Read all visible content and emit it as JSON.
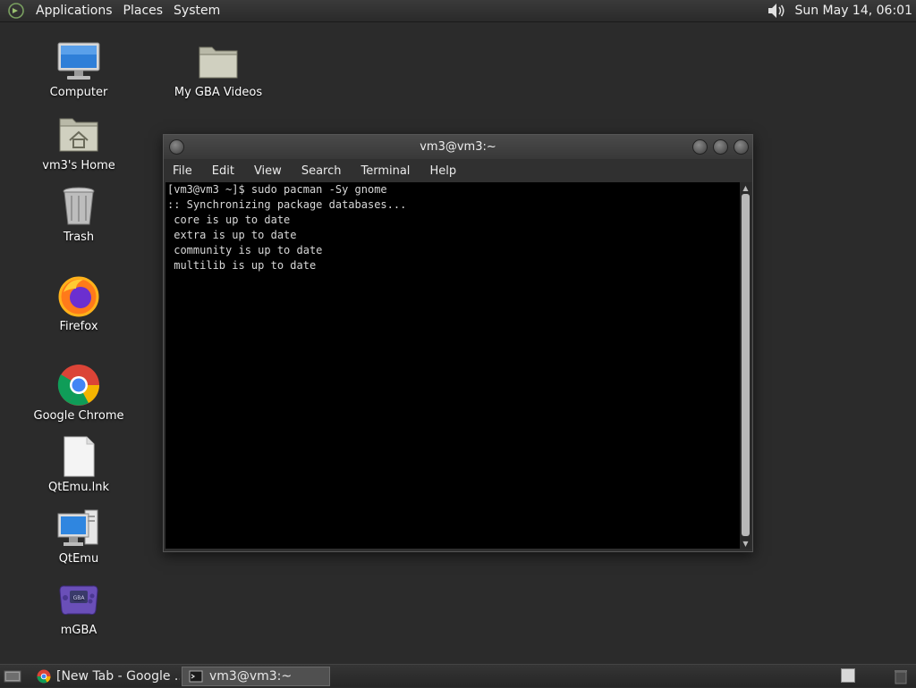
{
  "top_panel": {
    "menus": [
      "Applications",
      "Places",
      "System"
    ],
    "clock": "Sun May 14, 06:01"
  },
  "desktop_icons": [
    {
      "label": "Computer",
      "icon": "computer-icon"
    },
    {
      "label": "My GBA Videos",
      "icon": "folder-icon"
    },
    {
      "label": "vm3's Home",
      "icon": "home-folder-icon"
    },
    {
      "label": "Trash",
      "icon": "trash-icon"
    },
    {
      "label": "Firefox",
      "icon": "firefox-icon"
    },
    {
      "label": "Google Chrome",
      "icon": "chrome-icon"
    },
    {
      "label": "QtEmu.lnk",
      "icon": "file-icon"
    },
    {
      "label": "QtEmu",
      "icon": "qtemu-icon"
    },
    {
      "label": "mGBA",
      "icon": "mgba-icon"
    }
  ],
  "terminal": {
    "title": "vm3@vm3:~",
    "menus": [
      "File",
      "Edit",
      "View",
      "Search",
      "Terminal",
      "Help"
    ],
    "lines": [
      "[vm3@vm3 ~]$ sudo pacman -Sy gnome",
      ":: Synchronizing package databases...",
      " core is up to date",
      " extra is up to date",
      " community is up to date",
      " multilib is up to date"
    ]
  },
  "taskbar": {
    "tasks": [
      {
        "label": "[New Tab - Google ...",
        "icon": "chrome-icon",
        "active": false
      },
      {
        "label": "vm3@vm3:~",
        "icon": "terminal-icon",
        "active": true
      }
    ]
  }
}
